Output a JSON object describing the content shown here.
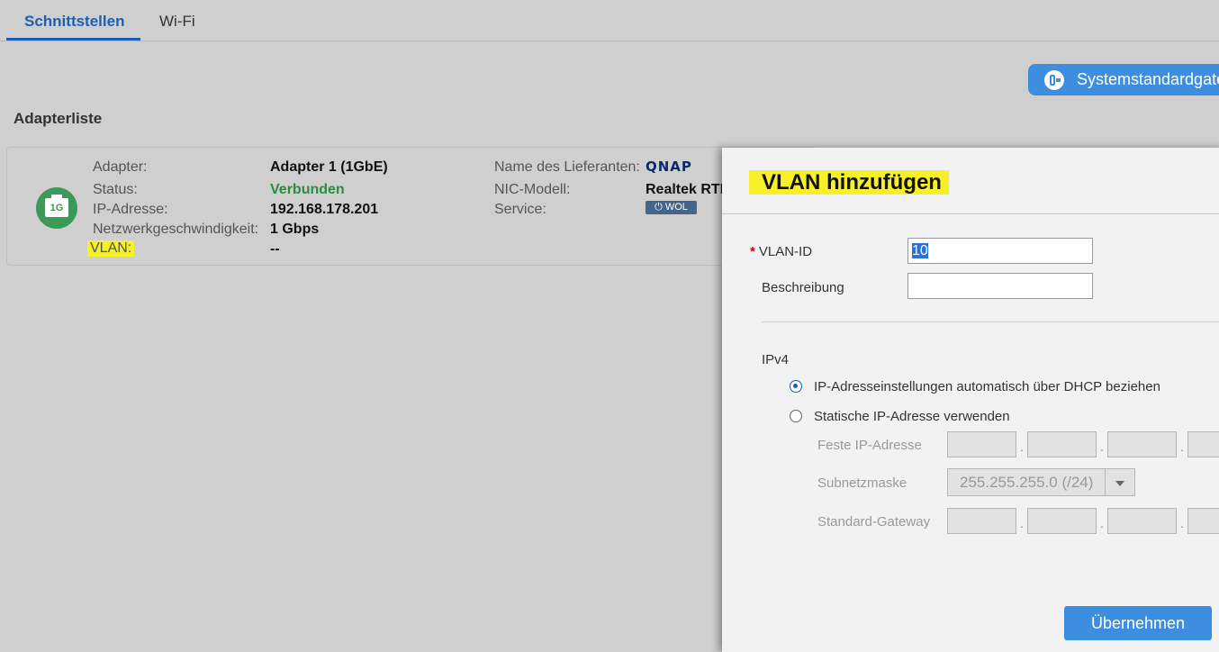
{
  "tabs": [
    {
      "label": "Schnittstellen",
      "active": true
    },
    {
      "label": "Wi-Fi",
      "active": false
    }
  ],
  "gateway_button": {
    "label": "Systemstandardgate"
  },
  "section_title": "Adapterliste",
  "adapter": {
    "icon_label": "1G",
    "labels": {
      "adapter": "Adapter:",
      "status": "Status:",
      "ip": "IP-Adresse:",
      "speed": "Netzwerkgeschwindigkeit:",
      "vlan": "VLAN:",
      "vendor": "Name des Lieferanten:",
      "nic": "NIC-Modell:",
      "service": "Service:"
    },
    "values": {
      "adapter": "Adapter 1 (1GbE)",
      "status": "Verbunden",
      "ip": "192.168.178.201",
      "speed": "1 Gbps",
      "vlan": "--",
      "vendor_logo": "QNAP",
      "nic": "Realtek RTL",
      "service_badge": "⏻ WOL"
    },
    "status_color": "#2e8b3e"
  },
  "modal": {
    "title": "VLAN hinzufügen",
    "vlan_id_label": "VLAN-ID",
    "vlan_id_value": "10",
    "description_label": "Beschreibung",
    "description_value": "",
    "ipv4_label": "IPv4",
    "option_dhcp": "IP-Adresseinstellungen automatisch über DHCP beziehen",
    "option_static": "Statische IP-Adresse verwenden",
    "fixed_ip_label": "Feste IP-Adresse",
    "subnet_label": "Subnetzmaske",
    "subnet_value": "255.255.255.0 (/24)",
    "gateway_label": "Standard-Gateway",
    "octet_separator": ".",
    "apply_label": "Übernehmen"
  },
  "colors": {
    "accent": "#3d8ee0",
    "highlight": "#f5f02a",
    "tab_active": "#1a5fb4"
  }
}
